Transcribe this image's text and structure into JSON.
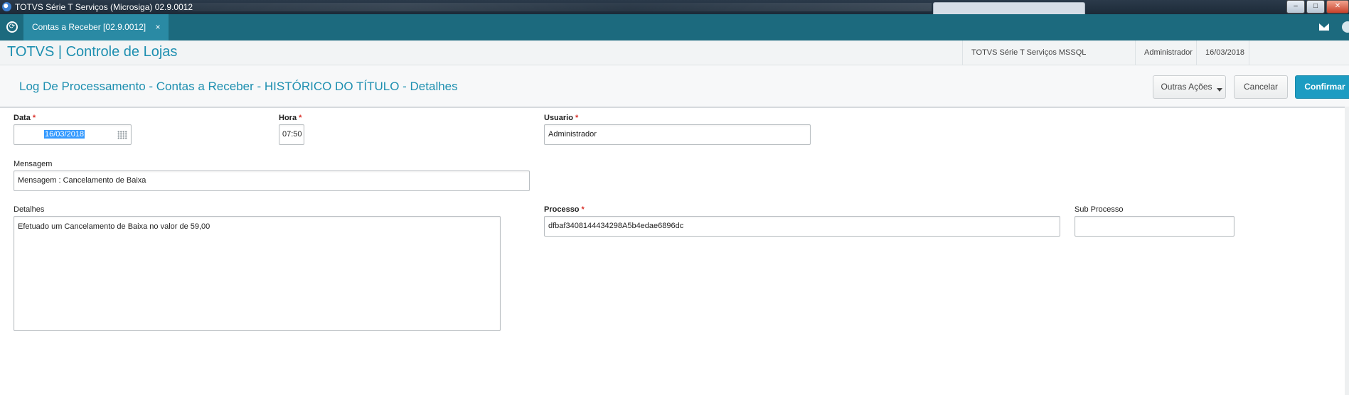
{
  "window": {
    "title": "TOTVS Série T Serviços (Microsiga) 02.9.0012",
    "buttons": [
      "–",
      "□",
      "✕"
    ]
  },
  "tabs": [
    {
      "label": "Contas a Receber [02.9.0012]",
      "close": "×"
    }
  ],
  "header": {
    "brand": "TOTVS | Controle de Lojas",
    "environment": "TOTVS Série T Serviços MSSQL",
    "user": "Administrador",
    "date": "16/03/2018"
  },
  "page": {
    "title": "Log De Processamento - Contas a Receber - HISTÓRICO DO TÍTULO - Detalhes",
    "actions": {
      "other": "Outras Ações",
      "cancel": "Cancelar",
      "confirm": "Confirmar"
    }
  },
  "form": {
    "data": {
      "label": "Data",
      "required": "*",
      "value": "16/03/2018"
    },
    "hora": {
      "label": "Hora",
      "required": "*",
      "value": "07:50"
    },
    "usuario": {
      "label": "Usuario",
      "required": "*",
      "value": "Administrador"
    },
    "mensagem": {
      "label": "Mensagem",
      "value": "Mensagem : Cancelamento de Baixa"
    },
    "detalhes": {
      "label": "Detalhes",
      "value": "Efetuado um Cancelamento de Baixa no valor de 59,00"
    },
    "processo": {
      "label": "Processo",
      "required": "*",
      "value": "dfbaf3408144434298A5b4edae6896dc"
    },
    "sub_processo": {
      "label": "Sub Processo",
      "value": ""
    }
  },
  "colors": {
    "tabbar": "#1c6a7e",
    "accent": "#1d8fb0",
    "primary_button": "#1d9cc2",
    "required": "#d9312a"
  },
  "icons": [
    "app-icon",
    "home-icon",
    "mail-icon",
    "calendar-icon",
    "caret-down-icon"
  ]
}
